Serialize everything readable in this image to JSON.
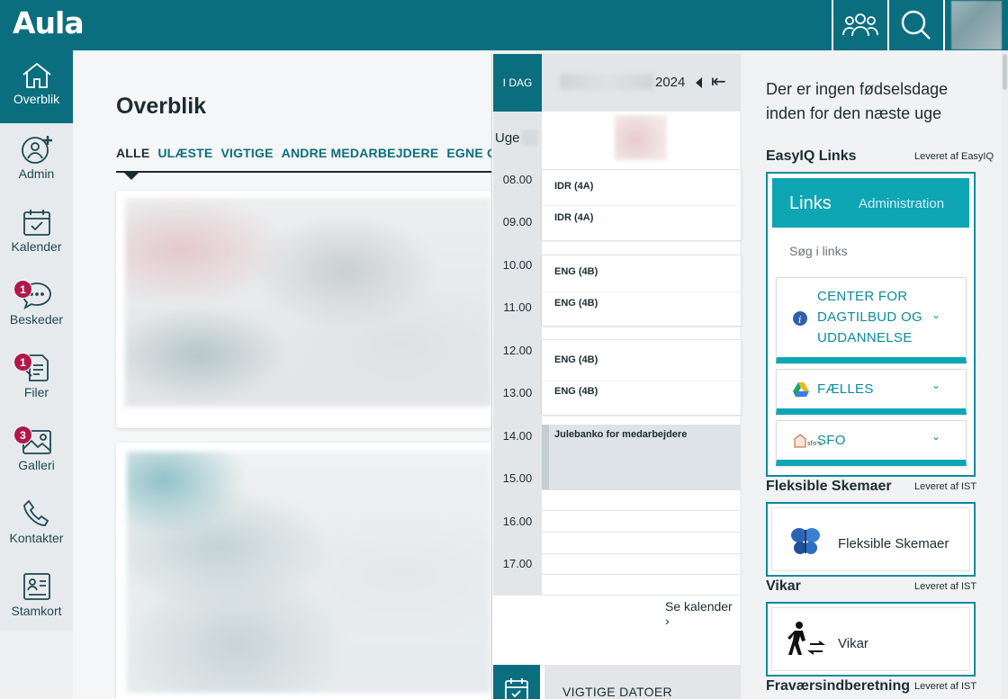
{
  "app": {
    "logo": "Aula"
  },
  "topbar": {
    "groups_icon": "groups-icon",
    "search_icon": "search-icon"
  },
  "sidebar": {
    "items": [
      {
        "label": "Overblik",
        "icon": "home-icon",
        "active": true
      },
      {
        "label": "Admin",
        "icon": "add-user-icon"
      },
      {
        "label": "Kalender",
        "icon": "calendar-icon"
      },
      {
        "label": "Beskeder",
        "icon": "chat-icon",
        "badge": "1"
      },
      {
        "label": "Filer",
        "icon": "files-icon",
        "badge": "1"
      },
      {
        "label": "Galleri",
        "icon": "gallery-icon",
        "badge": "3"
      },
      {
        "label": "Kontakter",
        "icon": "phone-icon"
      },
      {
        "label": "Stamkort",
        "icon": "profile-card-icon"
      }
    ]
  },
  "main": {
    "title": "Overblik",
    "tabs": [
      "ALLE",
      "ULÆSTE",
      "VIGTIGE",
      "ANDRE MEDARBEJDERE",
      "EGNE OP"
    ]
  },
  "calendar": {
    "today_label": "I DAG",
    "year": "2024",
    "week_label": "Uge",
    "hours": [
      "08.00",
      "09.00",
      "10.00",
      "11.00",
      "12.00",
      "13.00",
      "14.00",
      "15.00",
      "16.00",
      "17.00"
    ],
    "events": [
      "IDR (4A)",
      "IDR (4A)",
      "ENG (4B)",
      "ENG (4B)",
      "ENG (4B)",
      "ENG (4B)",
      "Julebanko for medarbejdere"
    ],
    "see_calendar": "Se kalender",
    "important_dates": "VIGTIGE DATOER"
  },
  "right": {
    "birthdays": "Der er ingen fødselsdage inden for den næste uge",
    "easyiq": {
      "title": "EasyIQ Links",
      "supplier": "Leveret af EasyIQ",
      "tab_links": "Links",
      "tab_admin": "Administration",
      "search": "Søg i links",
      "items": [
        "CENTER FOR DAGTILBUD OG UDDANNELSE",
        "FÆLLES",
        "SFO"
      ]
    },
    "fleksible": {
      "title": "Fleksible Skemaer",
      "supplier": "Leveret af IST",
      "label": "Fleksible Skemaer"
    },
    "vikar": {
      "title": "Vikar",
      "supplier": "Leveret af IST",
      "label": "Vikar"
    },
    "fravaer": {
      "title": "Fraværsindberetning",
      "supplier": "Leveret af IST"
    }
  },
  "colors": {
    "brand": "#0b6e7e",
    "accent": "#0ea5b5",
    "badge": "#b0184b"
  }
}
